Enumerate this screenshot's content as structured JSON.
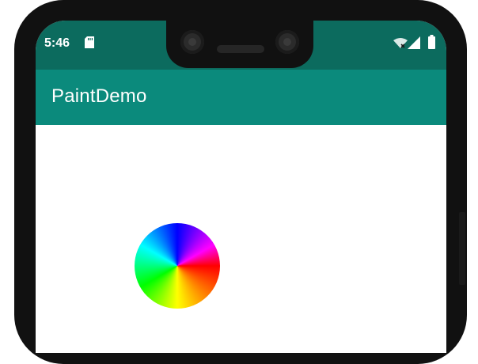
{
  "status_bar": {
    "time": "5:46",
    "icons": [
      "sd-card-icon",
      "wifi-icon",
      "signal-icon",
      "battery-icon"
    ]
  },
  "app_bar": {
    "title": "PaintDemo"
  },
  "canvas": {
    "drawing": "color-wheel"
  },
  "colors": {
    "status_bar": "#0c6b5e",
    "app_bar": "#0b8a7c",
    "frame": "#111111"
  }
}
